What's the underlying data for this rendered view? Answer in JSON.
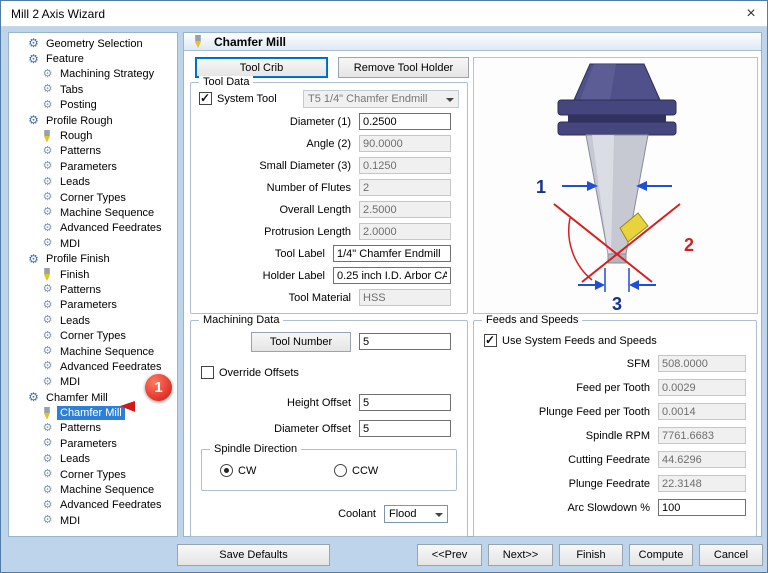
{
  "window": {
    "title": "Mill 2 Axis Wizard",
    "close_glyph": "×"
  },
  "tree": {
    "items": [
      {
        "label": "Geometry Selection",
        "level": 0,
        "icon": "gear-icon"
      },
      {
        "label": "Feature",
        "level": 0,
        "icon": "gear-icon"
      },
      {
        "label": "Machining Strategy",
        "level": 1,
        "icon": "gears-icon"
      },
      {
        "label": "Tabs",
        "level": 1,
        "icon": "gears-icon"
      },
      {
        "label": "Posting",
        "level": 1,
        "icon": "gears-icon"
      },
      {
        "label": "Profile Rough",
        "level": 0,
        "icon": "gear-icon"
      },
      {
        "label": "Rough",
        "level": 1,
        "icon": "tool-icon"
      },
      {
        "label": "Patterns",
        "level": 1,
        "icon": "gears-icon"
      },
      {
        "label": "Parameters",
        "level": 1,
        "icon": "gears-icon"
      },
      {
        "label": "Leads",
        "level": 1,
        "icon": "gears-icon"
      },
      {
        "label": "Corner Types",
        "level": 1,
        "icon": "gears-icon"
      },
      {
        "label": "Machine Sequence",
        "level": 1,
        "icon": "gears-icon"
      },
      {
        "label": "Advanced Feedrates",
        "level": 1,
        "icon": "gears-icon"
      },
      {
        "label": "MDI",
        "level": 1,
        "icon": "gears-icon"
      },
      {
        "label": "Profile Finish",
        "level": 0,
        "icon": "gear-icon"
      },
      {
        "label": "Finish",
        "level": 1,
        "icon": "tool-icon"
      },
      {
        "label": "Patterns",
        "level": 1,
        "icon": "gears-icon"
      },
      {
        "label": "Parameters",
        "level": 1,
        "icon": "gears-icon"
      },
      {
        "label": "Leads",
        "level": 1,
        "icon": "gears-icon"
      },
      {
        "label": "Corner Types",
        "level": 1,
        "icon": "gears-icon"
      },
      {
        "label": "Machine Sequence",
        "level": 1,
        "icon": "gears-icon"
      },
      {
        "label": "Advanced Feedrates",
        "level": 1,
        "icon": "gears-icon"
      },
      {
        "label": "MDI",
        "level": 1,
        "icon": "gears-icon"
      },
      {
        "label": "Chamfer Mill",
        "level": 0,
        "icon": "gear-icon"
      },
      {
        "label": "Chamfer Mill",
        "level": 1,
        "icon": "tool-icon",
        "selected": true
      },
      {
        "label": "Patterns",
        "level": 1,
        "icon": "gears-icon"
      },
      {
        "label": "Parameters",
        "level": 1,
        "icon": "gears-icon"
      },
      {
        "label": "Leads",
        "level": 1,
        "icon": "gears-icon"
      },
      {
        "label": "Corner Types",
        "level": 1,
        "icon": "gears-icon"
      },
      {
        "label": "Machine Sequence",
        "level": 1,
        "icon": "gears-icon"
      },
      {
        "label": "Advanced Feedrates",
        "level": 1,
        "icon": "gears-icon"
      },
      {
        "label": "MDI",
        "level": 1,
        "icon": "gears-icon"
      }
    ]
  },
  "annotation": {
    "label": "1"
  },
  "header": {
    "title": "Chamfer Mill"
  },
  "toolbar": {
    "tool_crib": "Tool Crib",
    "remove_tool_holder": "Remove Tool Holder"
  },
  "tool_data": {
    "group_title": "Tool Data",
    "system_tool_label": "System Tool",
    "system_tool_checked": true,
    "tool_select_value": "T5 1/4\" Chamfer Endmill",
    "rows": [
      {
        "label": "Diameter (1)",
        "value": "0.2500",
        "disabled": false
      },
      {
        "label": "Angle (2)",
        "value": "90.0000",
        "disabled": true
      },
      {
        "label": "Small Diameter (3)",
        "value": "0.1250",
        "disabled": true
      },
      {
        "label": "Number of Flutes",
        "value": "2",
        "disabled": true
      },
      {
        "label": "Overall Length",
        "value": "2.5000",
        "disabled": true
      },
      {
        "label": "Protrusion Length",
        "value": "2.0000",
        "disabled": true
      },
      {
        "label": "Tool Label",
        "value": "1/4\" Chamfer Endmill",
        "disabled": false,
        "wide": true
      },
      {
        "label": "Holder Label",
        "value": "0.25 inch I.D. Arbor CAT 40",
        "disabled": false,
        "wide": true
      },
      {
        "label": "Tool Material",
        "value": "HSS",
        "disabled": true
      }
    ]
  },
  "machining_data": {
    "group_title": "Machining Data",
    "tool_number_button": "Tool Number",
    "tool_number_value": "5",
    "override_offsets_label": "Override Offsets",
    "override_offsets_checked": false,
    "height_offset_label": "Height Offset",
    "height_offset_value": "5",
    "diameter_offset_label": "Diameter Offset",
    "diameter_offset_value": "5",
    "spindle_direction": {
      "group_title": "Spindle Direction",
      "cw_label": "CW",
      "cw_checked": true,
      "ccw_label": "CCW",
      "ccw_checked": false
    },
    "coolant_label": "Coolant",
    "coolant_value": "Flood"
  },
  "feeds": {
    "group_title": "Feeds and Speeds",
    "use_system_label": "Use System Feeds and Speeds",
    "use_system_checked": true,
    "rows": [
      {
        "label": "SFM",
        "value": "508.0000",
        "disabled": true
      },
      {
        "label": "Feed per Tooth",
        "value": "0.0029",
        "disabled": true
      },
      {
        "label": "Plunge Feed per Tooth",
        "value": "0.0014",
        "disabled": true
      },
      {
        "label": "Spindle RPM",
        "value": "7761.6683",
        "disabled": true
      },
      {
        "label": "Cutting Feedrate",
        "value": "44.6296",
        "disabled": true
      },
      {
        "label": "Plunge Feedrate",
        "value": "22.3148",
        "disabled": true
      },
      {
        "label": "Arc Slowdown %",
        "value": "100",
        "disabled": false
      }
    ]
  },
  "tool_image": {
    "label_1": "1",
    "label_2": "2",
    "label_3": "3"
  },
  "footer": {
    "save_defaults": "Save Defaults",
    "prev": "<<Prev",
    "next": "Next>>",
    "finish": "Finish",
    "compute": "Compute",
    "cancel": "Cancel"
  }
}
